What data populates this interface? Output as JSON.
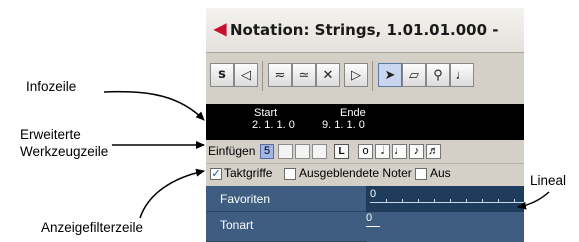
{
  "annotations": {
    "infozeile": "Infozeile",
    "erweiterte_line1": "Erweiterte",
    "erweiterte_line2": "Werkzeugzeile",
    "anzeigefilterzeile": "Anzeigefilterzeile",
    "lineal": "Lineal"
  },
  "window": {
    "title": "Notation: Strings, 1.01.01.000 -"
  },
  "toolbar": {
    "icons": [
      "solo-icon",
      "speaker-icon",
      "eq-down-icon",
      "eq-down-alt-icon",
      "mute-icon",
      "insert-icon",
      "arrow-pointer-icon",
      "eraser-icon",
      "magnifier-icon",
      "note-icon"
    ]
  },
  "infoline": {
    "start_label": "Start",
    "start_value": "2. 1. 1.   0",
    "end_label": "Ende",
    "end_value": "9. 1. 1.   0"
  },
  "extended_toolbar": {
    "insert_label": "Einfügen",
    "voice_value": "5",
    "l_button": "L",
    "notes": [
      "𝅝",
      "𝅗𝅥",
      "♩",
      "♪",
      "♬"
    ]
  },
  "filter_bar": {
    "taktgriffe_label": "Taktgriffe",
    "taktgriffe_checked": true,
    "hidden_notes_label": "Ausgeblendete Noter",
    "hidden_notes_checked": false,
    "third_label": "Aus"
  },
  "inspector": {
    "rows": [
      "Favoriten",
      "Tonart"
    ],
    "ruler_start": "0",
    "key_value": "0"
  }
}
